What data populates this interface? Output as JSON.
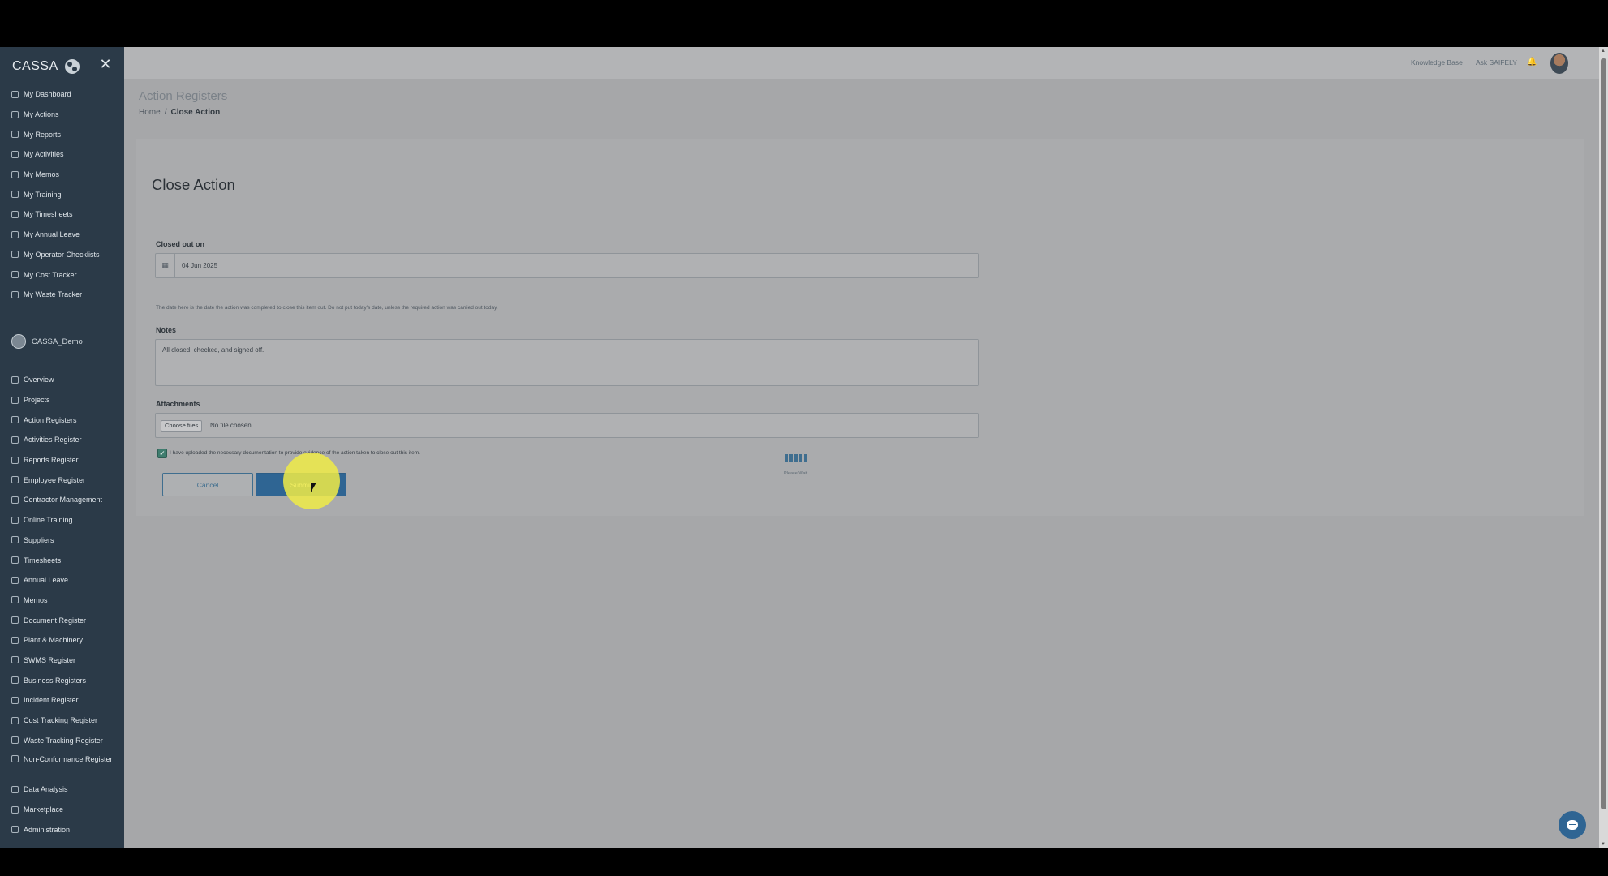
{
  "sidebar": {
    "brand": "CASSA",
    "personal_items": [
      {
        "label": "My Dashboard"
      },
      {
        "label": "My Actions"
      },
      {
        "label": "My Reports"
      },
      {
        "label": "My Activities"
      },
      {
        "label": "My Memos"
      },
      {
        "label": "My Training"
      },
      {
        "label": "My Timesheets"
      },
      {
        "label": "My Annual Leave"
      },
      {
        "label": "My Operator Checklists"
      },
      {
        "label": "My Cost Tracker"
      },
      {
        "label": "My Waste Tracker"
      }
    ],
    "org_name": "CASSA_Demo",
    "org_items": [
      {
        "label": "Overview"
      },
      {
        "label": "Projects"
      },
      {
        "label": "Action Registers"
      },
      {
        "label": "Activities Register"
      },
      {
        "label": "Reports Register"
      },
      {
        "label": "Employee Register"
      },
      {
        "label": "Contractor Management"
      },
      {
        "label": "Online Training"
      },
      {
        "label": "Suppliers"
      },
      {
        "label": "Timesheets"
      },
      {
        "label": "Annual Leave"
      },
      {
        "label": "Memos"
      },
      {
        "label": "Document Register"
      },
      {
        "label": "Plant & Machinery"
      },
      {
        "label": "SWMS Register"
      },
      {
        "label": "Business Registers"
      },
      {
        "label": "Incident Register"
      },
      {
        "label": "Cost Tracking Register"
      },
      {
        "label": "Waste Tracking Register"
      },
      {
        "label": "Non-Conformance Register"
      },
      {
        "label": "Data Analysis"
      },
      {
        "label": "Marketplace"
      },
      {
        "label": "Administration"
      }
    ]
  },
  "topbar": {
    "knowledge_base": "Knowledge Base",
    "ask_saifely": "Ask SAIFELY"
  },
  "header": {
    "title": "Action Registers",
    "breadcrumb_home": "Home",
    "breadcrumb_sep": "/",
    "breadcrumb_current": "Close Action"
  },
  "form": {
    "title": "Close Action",
    "closed_label": "Closed out on",
    "closed_value": "04 Jun 2025",
    "help_text": "The date here is the date the action was completed to close this item out. Do not put today's date, unless the required action was carried out today.",
    "notes_label": "Notes",
    "notes_value": "All closed, checked, and signed off.",
    "attachments_label": "Attachments",
    "choose_files": "Choose files",
    "no_file": "No file chosen",
    "confirm_text": "I have uploaded the necessary documentation to provide evidence of the action taken to close out this item.",
    "confirm_checked": true,
    "cancel_label": "Cancel",
    "submit_label": "Submit"
  },
  "loader": {
    "text": "Please Wait..."
  },
  "colors": {
    "sidebar_bg": "#2b3a48",
    "primary": "#2f6593",
    "check": "#3f7d6f",
    "highlight": "#f0eb46"
  }
}
